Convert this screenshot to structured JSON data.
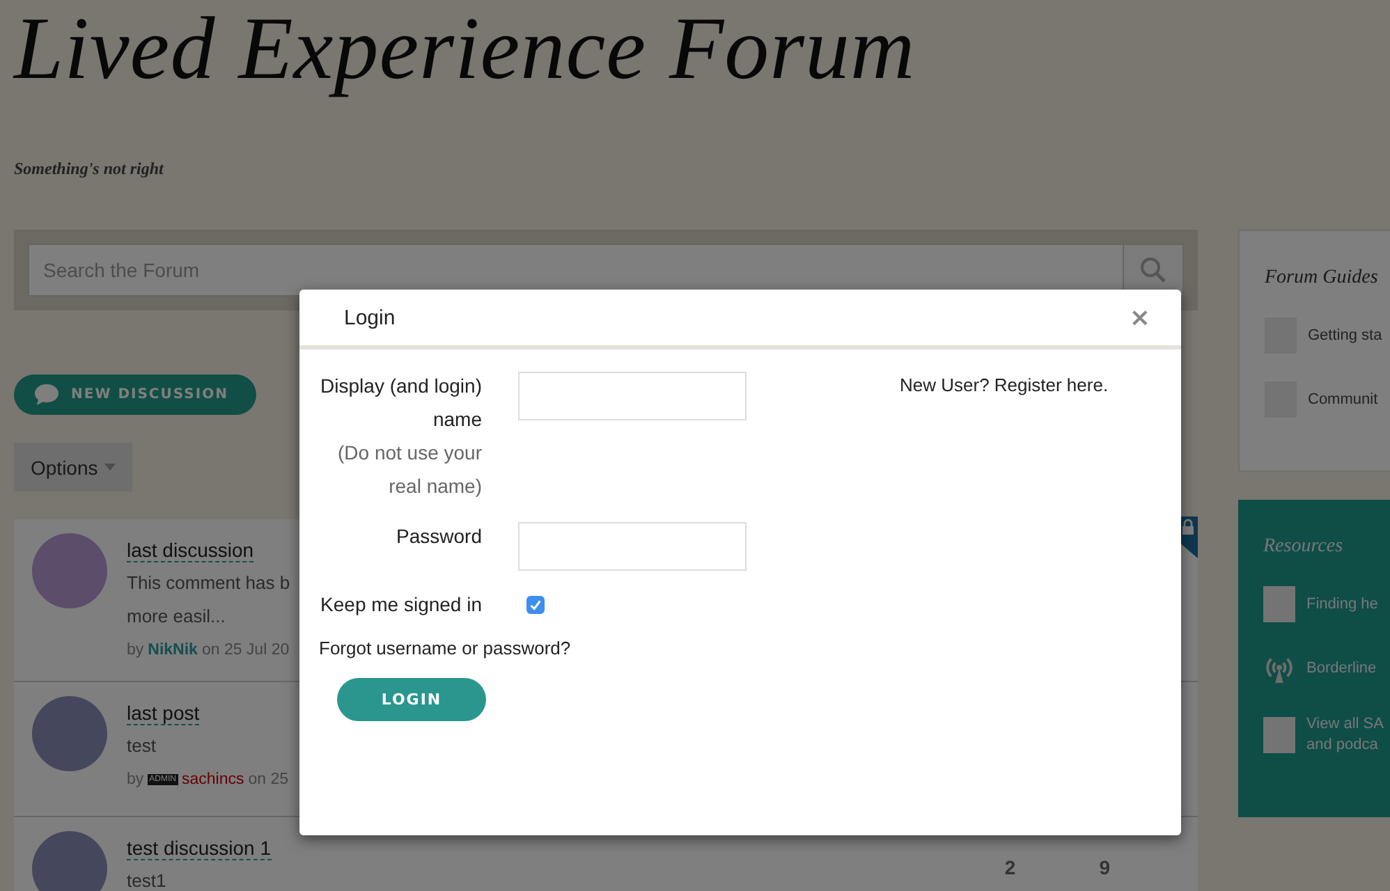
{
  "site": {
    "title": "Lived Experience Forum",
    "tagline": "Something's not right"
  },
  "search": {
    "placeholder": "Search the Forum"
  },
  "new_discussion_button": "NEW DISCUSSION",
  "options_button": "Options",
  "discussions": [
    {
      "title": "last discussion",
      "excerpt": [
        "This comment has b",
        "more easil..."
      ],
      "by": "by",
      "author": "NikNik",
      "on": "on 25 Jul 20",
      "locked": true
    },
    {
      "title": "last post",
      "excerpt": [
        "test"
      ],
      "by": "by",
      "author": "sachincs",
      "role_badge": "ADMIN",
      "on": "on 25",
      "locked": false
    },
    {
      "title": "test discussion 1",
      "excerpt": [
        "test1"
      ],
      "locked": false,
      "counts": [
        "2",
        "9"
      ]
    }
  ],
  "forum_guides": {
    "title": "Forum Guides",
    "items": [
      {
        "label": [
          "Getting sta"
        ],
        "kind": "logo"
      },
      {
        "label": [
          "Communit"
        ],
        "kind": "logo"
      }
    ]
  },
  "resources": {
    "title": "Resources",
    "items": [
      {
        "label": [
          "Finding he"
        ],
        "kind": "logo"
      },
      {
        "label": [
          "Borderline"
        ],
        "kind": "broadcast"
      },
      {
        "label": [
          "View all SA",
          "and podca"
        ],
        "kind": "logo"
      }
    ]
  },
  "login_dialog": {
    "title": "Login",
    "close": "×",
    "fields": [
      {
        "label": "Display (and login) name",
        "hint": "(Do not use your real name)"
      },
      {
        "label": "Password"
      }
    ],
    "remember": {
      "label": "Keep me signed in",
      "checked": true
    },
    "forgot_link": "Forgot username or password?",
    "submit": "LOGIN",
    "register_link": "New User? Register here."
  }
}
